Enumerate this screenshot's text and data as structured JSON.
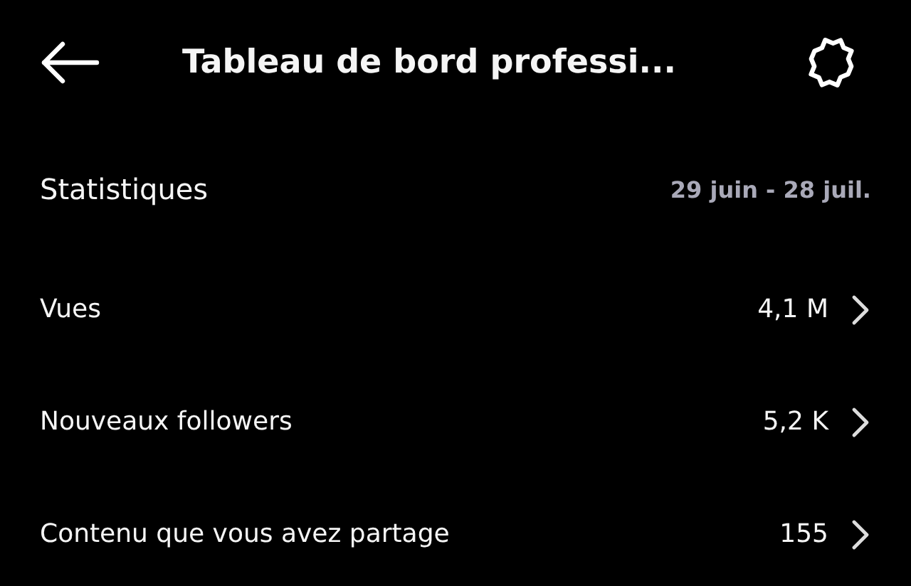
{
  "header": {
    "title": "Tableau de bord professi..."
  },
  "section": {
    "title": "Statistiques",
    "date_range": "29 juin - 28 juil."
  },
  "rows": [
    {
      "label": "Vues",
      "value": "4,1 M"
    },
    {
      "label": "Nouveaux followers",
      "value": "5,2 K"
    },
    {
      "label": "Contenu que vous avez partage",
      "value": "155"
    }
  ]
}
